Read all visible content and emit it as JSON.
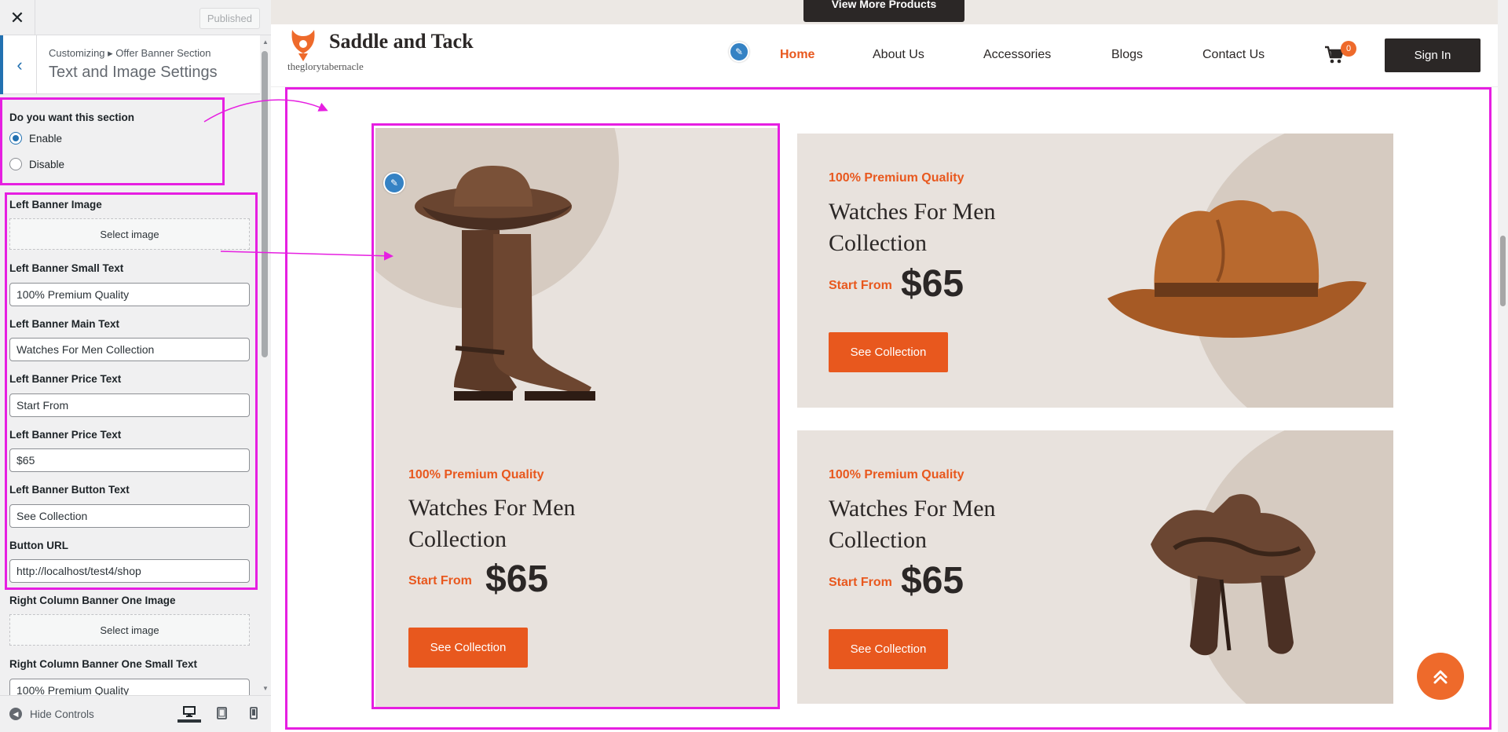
{
  "customizer": {
    "close_icon": "close-icon",
    "published_label": "Published",
    "breadcrumb": "Customizing ▸ Offer Banner Section",
    "section_title": "Text and Image Settings",
    "section_toggle": {
      "label": "Do you want this section",
      "options": [
        "Enable",
        "Disable"
      ],
      "selected": "Enable"
    },
    "controls": {
      "left_image": {
        "label": "Left Banner Image",
        "button": "Select image"
      },
      "left_small": {
        "label": "Left Banner Small Text",
        "value": "100% Premium Quality"
      },
      "left_main": {
        "label": "Left Banner Main Text",
        "value": "Watches For Men Collection"
      },
      "left_price_text": {
        "label": "Left Banner Price Text",
        "value": "Start From"
      },
      "left_price": {
        "label": "Left Banner Price Text",
        "value": "$65"
      },
      "left_button": {
        "label": "Left Banner Button Text",
        "value": "See Collection"
      },
      "button_url": {
        "label": "Button URL",
        "value": "http://localhost/test4/shop"
      },
      "right_one_image": {
        "label": "Right Column Banner One Image",
        "button": "Select image"
      },
      "right_one_small": {
        "label": "Right Column Banner One Small Text",
        "value": "100% Premium Quality"
      }
    },
    "footer": {
      "hide_controls": "Hide Controls",
      "devices": [
        "desktop-icon",
        "tablet-icon",
        "mobile-icon"
      ],
      "active_device": "desktop"
    },
    "highlight_color": "#e61fe1"
  },
  "site": {
    "top_button": "View More Products",
    "brand": "Saddle and Tack",
    "tagline": "theglorytabernacle",
    "nav": [
      "Home",
      "About Us",
      "Accessories",
      "Blogs",
      "Contact Us"
    ],
    "active_nav": "Home",
    "cart_count": "0",
    "signin": "Sign In",
    "accent": "#e8581e",
    "dark": "#2b2726",
    "banners": {
      "left": {
        "small": "100% Premium Quality",
        "main": "Watches For Men Collection",
        "from": "Start From",
        "price": "$65",
        "button": "See Collection",
        "image": "boots-and-hat-image"
      },
      "right_one": {
        "small": "100% Premium Quality",
        "main": "Watches For Men Collection",
        "from": "Start From",
        "price": "$65",
        "button": "See Collection",
        "image": "cowboy-hat-image"
      },
      "right_two": {
        "small": "100% Premium Quality",
        "main": "Watches For Men Collection",
        "from": "Start From",
        "price": "$65",
        "button": "See Collection",
        "image": "saddle-image"
      }
    },
    "scroll_top_icon": "double-chevron-up-icon"
  }
}
